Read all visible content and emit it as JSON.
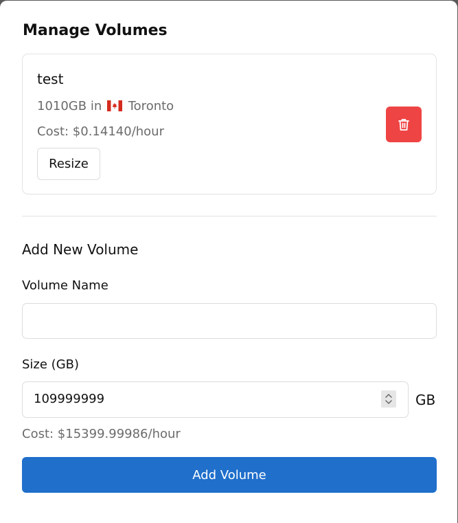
{
  "modal": {
    "title": "Manage Volumes"
  },
  "volume": {
    "name": "test",
    "size": "1010GB",
    "in_text": "in",
    "location": "Toronto",
    "flag_icon": "canada-flag-icon",
    "cost": "Cost: $0.14140/hour",
    "resize_label": "Resize",
    "delete_icon": "trash-icon",
    "delete_color": "#ef4444"
  },
  "add_form": {
    "section_title": "Add New Volume",
    "name_label": "Volume Name",
    "name_value": "",
    "size_label": "Size (GB)",
    "size_value": "109999999",
    "size_unit": "GB",
    "cost": "Cost: $15399.99986/hour",
    "submit_label": "Add Volume",
    "submit_color": "#1f6fcb"
  }
}
